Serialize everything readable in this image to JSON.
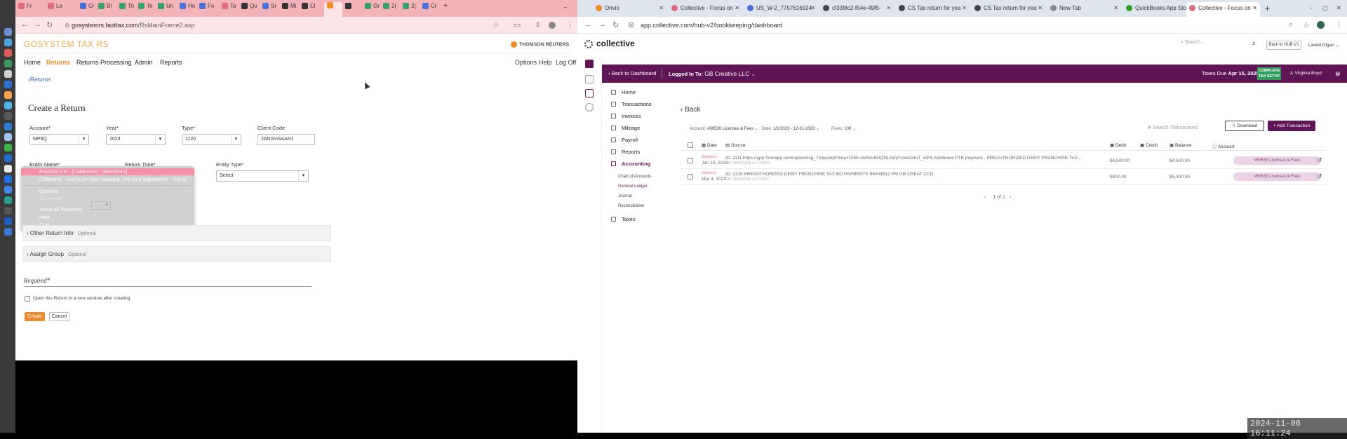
{
  "left_window": {
    "tabs": [
      "Fr",
      "La",
      "Cr",
      "Bl",
      "Th",
      "Te",
      "Un",
      "Ho",
      "Fo",
      "Ta",
      "Qu",
      "Sr",
      "Mi",
      "Cl",
      "",
      "",
      "Gr",
      "2(",
      "2(",
      "Cr"
    ],
    "url_domain": "gosystemrs.fasttax.com",
    "url_path": "/RsMainFrame2.asp",
    "app_logo": "GOSYSTEM TAX RS",
    "vendor_logo": "THOMSON REUTERS",
    "menu": [
      "Home",
      "Returns",
      "Returns Processing",
      "Admin",
      "Reports"
    ],
    "right_links": [
      "Options",
      "Help",
      "Log Off"
    ],
    "back_link": "Returns",
    "page_title": "Create a Return",
    "fields": {
      "account": {
        "label": "Account*",
        "value": "MP6Q"
      },
      "year": {
        "label": "Year*",
        "value": "2023"
      },
      "type": {
        "label": "Type*",
        "value": "1120"
      },
      "client_code": {
        "label": "Client Code",
        "value": "2ANSVGAAN1"
      },
      "entity_name": {
        "label": "Entity Name*"
      },
      "return_type": {
        "label": "Return Type*"
      },
      "entity_type": {
        "label": "Entity Type*",
        "value": "Select"
      }
    },
    "context_menu": {
      "selected": "Practice CS - [Collective] - [Members]",
      "subtitle": "Collective - Focus on your passion, not your paperwork - Googl",
      "options": "Options",
      "show_all": "Show All Windows",
      "hide": "Hide",
      "quit": "Quit",
      "behind_label": "Ca...sname*"
    },
    "sections": [
      {
        "label": "Other Return Info",
        "tag": "Optional"
      },
      {
        "label": "Assign Group",
        "tag": "Optional"
      }
    ],
    "required_label": "Required*",
    "open_in_window": "Open this Return in a new window after creating.",
    "create_btn": "Create",
    "cancel_btn": "Cancel"
  },
  "right_window": {
    "tabs": [
      "Onvio",
      "Collective - Focus on",
      "US_W-2_7757616924",
      "cf33f8c2-f54e-49f5-",
      "CS Tax return for yea",
      "CS Tax return for yea",
      "New Tab",
      "QuickBooks App Sto",
      "Collective - Focus on"
    ],
    "url": "app.collective.com/hub-v2/bookkeeping/dashboard",
    "logo": "collective",
    "search_placeholder": "Search...",
    "hub_btn": "Back to HUB V1",
    "user": "Laurel Digan",
    "purple_bar": {
      "back": "Back to Dashboard",
      "logged_in": "Logged In To:",
      "company": "GB Creative LLC",
      "taxes_due_label": "Taxes Due",
      "taxes_due_date": "Apr 15, 2025",
      "setup_badge": "COMPLETE TAX SETUP",
      "advisor": "Virginia Boyd"
    },
    "sidebar": {
      "items": [
        "Home",
        "Transactions",
        "Invoices",
        "Mileage",
        "Payroll",
        "Reports",
        "Accounting"
      ],
      "sub_items": [
        "Chart of Accounts",
        "General Ledger",
        "Journal",
        "Reconciliation"
      ],
      "bottom": "Taxes"
    },
    "back": "Back",
    "filters": {
      "account_label": "Account:",
      "account_value": "#60530 Licenses & Fees",
      "date_label": "Date:",
      "date_value": "1/1/2023 - 12-31-2023",
      "rows_label": "Rows:",
      "rows_value": "100"
    },
    "search_transactions": "Search Transactions",
    "download_btn": "Download",
    "add_btn": "Add Transaction",
    "columns": [
      "Date",
      "Source",
      "Debit",
      "Credit",
      "Balance",
      "Account"
    ],
    "rows": [
      {
        "type": "Expense",
        "date": "Jan 10, 2023",
        "source": "ID: 1111 https://app.frontapp.com/open/msg_7n3pq3q9?key=2355-rW3Vu9OQNLGmjYsMuD3uT_xiiF8 Additional PTE payment - PREAUTHORIZED DEBIT FRANCHISE TAX...",
        "source_sub": "GB CREATIVE LLC12817",
        "debit": "$4,500.00",
        "credit": "",
        "balance": "$4,500.00",
        "account": "#60530 Licenses & Fees"
      },
      {
        "type": "Expense",
        "date": "Mar 4, 2023",
        "source": "ID: 1310 PREAUTHORIZED DEBIT FRANCHISE TAX BO PAYMENTS 96009812 PM GB CREAT CCD",
        "source_sub": "GB CREATIVE LLC12817",
        "debit": "$800.00",
        "credit": "",
        "balance": "$5,300.00",
        "account": "#60530 Licenses & Fees"
      }
    ],
    "pager": {
      "current": "1",
      "of": "of",
      "total": "1"
    }
  },
  "timestamp": "2024-11-06 16:11:24"
}
